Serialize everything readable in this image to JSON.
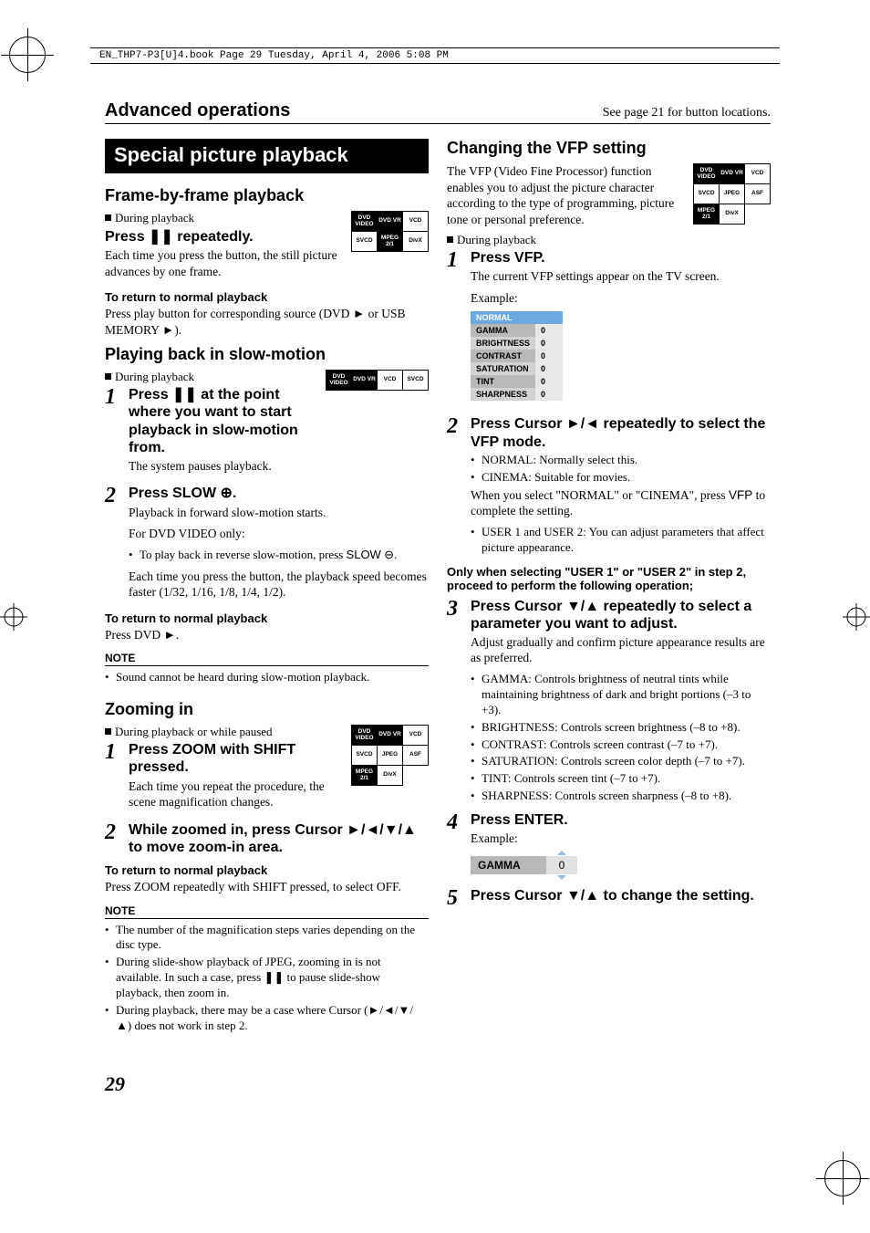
{
  "bookInfo": "EN_THP7-P3[U]4.book  Page 29  Tuesday, April 4, 2006  5:08 PM",
  "header": {
    "left": "Advanced operations",
    "right": "See page 21 for button locations."
  },
  "titleBar": "Special picture playback",
  "left": {
    "s1": {
      "h2": "Frame-by-frame playback",
      "during": "During playback",
      "h3_pre": "Press ",
      "h3_post": " repeatedly.",
      "body": "Each time you press the button, the still picture advances by one frame.",
      "ret_h": "To return to normal playback",
      "ret_pre": "Press play button for corresponding source (DVD ",
      "ret_mid": " or USB MEMORY ",
      "ret_post": ").",
      "formats": [
        [
          "DVD VIDEO",
          "DVD VR",
          "VCD"
        ],
        [
          "SVCD",
          "MPEG 2/1",
          "DivX"
        ]
      ]
    },
    "s2": {
      "h2": "Playing back in slow-motion",
      "during": "During playback",
      "formats": [
        [
          "DVD VIDEO",
          "DVD VR",
          "VCD",
          "SVCD"
        ]
      ],
      "step1_h_pre": "Press ",
      "step1_h_post": " at the point where you want to start playback in slow-motion from.",
      "step1_body": "The system pauses playback.",
      "step2_h_pre": "Press ",
      "step2_h_slow": "SLOW",
      "step2_h_post": ".",
      "step2_body1": "Playback in forward slow-motion starts.",
      "step2_body2": "For DVD VIDEO only:",
      "step2_bullet_pre": "To play back in reverse slow-motion, press ",
      "step2_bullet_slow": "SLOW",
      "step2_bullet_post": ".",
      "step2_body3": "Each time you press the button, the playback speed becomes faster (1/32, 1/16, 1/8, 1/4, 1/2).",
      "ret_h": "To return to normal playback",
      "ret_body_pre": "Press DVD ",
      "ret_body_post": ".",
      "note_h": "NOTE",
      "note1": "Sound cannot be heard during slow-motion playback."
    },
    "s3": {
      "h2": "Zooming in",
      "during": "During playback or while paused",
      "formats": [
        [
          "DVD VIDEO",
          "DVD VR",
          "VCD"
        ],
        [
          "SVCD",
          "JPEG",
          "ASF"
        ],
        [
          "MPEG 2/1",
          "DivX",
          ""
        ]
      ],
      "step1_h": "Press ZOOM with SHIFT pressed.",
      "step1_body": "Each time you repeat the procedure, the scene magnification changes.",
      "step2_h_pre": "While zoomed in, press Cursor ",
      "step2_h_post": " to move zoom-in area.",
      "ret_h": "To return to normal playback",
      "ret_body": "Press ZOOM repeatedly with SHIFT pressed, to select OFF.",
      "note_h": "NOTE",
      "note1": "The number of the magnification steps varies depending on the disc type.",
      "note2_pre": "During slide-show playback of JPEG, zooming in is not available. In such a case, press ",
      "note2_post": " to pause slide-show playback, then zoom in.",
      "note3_pre": "During playback, there may be a case where Cursor (",
      "note3_post": ") does not work in step 2."
    }
  },
  "right": {
    "h2": "Changing the VFP setting",
    "intro": "The VFP (Video Fine Processor) function enables you to adjust the picture character according to the type of programming, picture tone or personal preference.",
    "during": "During playback",
    "formats": [
      [
        "DVD VIDEO",
        "DVD VR",
        "VCD"
      ],
      [
        "SVCD",
        "JPEG",
        "ASF"
      ],
      [
        "MPEG 2/1",
        "DivX",
        ""
      ]
    ],
    "step1_h": "Press VFP.",
    "step1_body": "The current VFP settings appear on the TV screen.",
    "example": "Example:",
    "vfp_preset": "NORMAL",
    "vfp_rows": [
      {
        "k": "GAMMA",
        "v": "0"
      },
      {
        "k": "BRIGHTNESS",
        "v": "0"
      },
      {
        "k": "CONTRAST",
        "v": "0"
      },
      {
        "k": "SATURATION",
        "v": "0"
      },
      {
        "k": "TINT",
        "v": "0"
      },
      {
        "k": "SHARPNESS",
        "v": "0"
      }
    ],
    "step2_h_pre": "Press Cursor ",
    "step2_h_post": " repeatedly to select the VFP mode.",
    "step2_b1": "NORMAL: Normally select this.",
    "step2_b2": "CINEMA: Suitable for movies.",
    "step2_note_pre": "When you select \"NORMAL\" or \"CINEMA\", press ",
    "step2_note_vfp": "VFP",
    "step2_note_post": " to complete the setting.",
    "step2_b3": "USER 1 and USER 2: You can adjust parameters that affect picture appearance.",
    "only": "Only when selecting \"USER 1\" or \"USER 2\" in step 2, proceed to perform the following operation;",
    "step3_h_pre": "Press Cursor ",
    "step3_h_post": " repeatedly to select a parameter you want to adjust.",
    "step3_body": "Adjust gradually and confirm picture appearance results are as preferred.",
    "step3_p1": "GAMMA: Controls brightness of neutral tints while maintaining brightness of dark and bright portions (–3 to +3).",
    "step3_p2": "BRIGHTNESS: Controls screen brightness (–8 to +8).",
    "step3_p3": "CONTRAST: Controls screen contrast (–7 to +7).",
    "step3_p4": "SATURATION: Controls screen color depth (–7 to +7).",
    "step3_p5": "TINT: Controls screen tint (–7 to +7).",
    "step3_p6": "SHARPNESS: Controls screen sharpness (–8 to +8).",
    "step4_h": "Press ENTER.",
    "step4_example": "Example:",
    "gamma_label": "GAMMA",
    "gamma_val": "0",
    "step5_h_pre": "Press Cursor ",
    "step5_h_post": " to change the setting."
  },
  "pageNumber": "29",
  "icons": {
    "pause": "❚❚",
    "play": "►",
    "fwd_circle": "⊕",
    "rev_circle": "⊖",
    "right": "►",
    "left": "◄",
    "down": "▼",
    "up": "▲"
  }
}
